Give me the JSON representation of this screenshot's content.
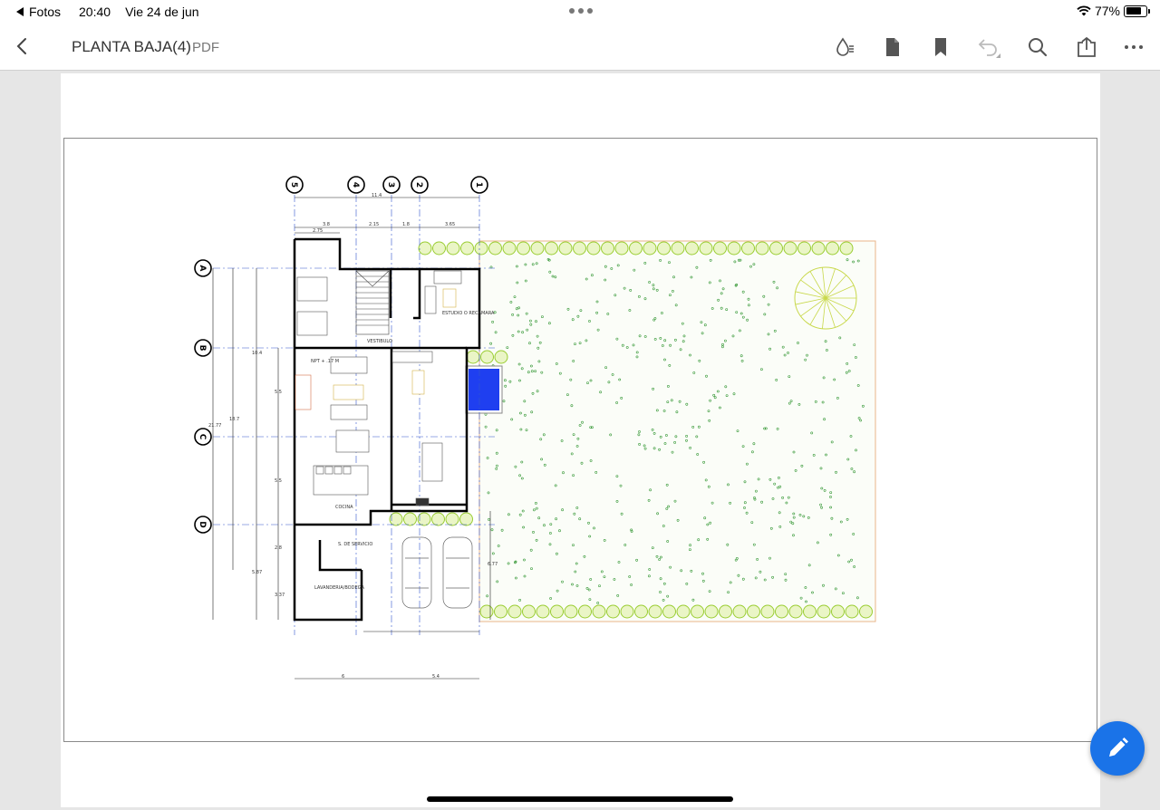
{
  "status_bar": {
    "back_app": "Fotos",
    "time": "20:40",
    "date": "Vie 24 de jun",
    "battery": "77%",
    "battery_level": 0.77
  },
  "nav": {
    "title": "PLANTA BAJA(4)",
    "file_type": "PDF",
    "tools": [
      "ink-drop-icon",
      "page-icon",
      "bookmark-icon",
      "undo-icon",
      "search-icon",
      "share-icon",
      "more-icon"
    ]
  },
  "plan": {
    "axes_vertical": [
      "5",
      "4",
      "3",
      "2",
      "1"
    ],
    "axes_horizontal": [
      "A",
      "B",
      "C",
      "D"
    ],
    "dims_top": [
      "11.4",
      "3.8",
      "2.15",
      "1.8",
      "3.65",
      "2.75"
    ],
    "dims_bottom": [
      "6",
      "5.4"
    ],
    "dims_left": [
      "21.77",
      "18.7",
      "10.4",
      "5.5",
      "5.5",
      "2.8",
      "5.87",
      "3.37"
    ],
    "room_labels": [
      "ESTUDIO O RECAMARA",
      "VESTIBULO",
      "COCINA",
      "S. DE SERVICIO",
      "LAVANDERIA/BODEGA",
      "NPT + .17 M"
    ],
    "right_dim": "6.77"
  },
  "colors": {
    "accent": "#1a73e8",
    "hedge": "#9acd32",
    "pool": "#1f3ff0",
    "grid_line": "#3355cc"
  }
}
